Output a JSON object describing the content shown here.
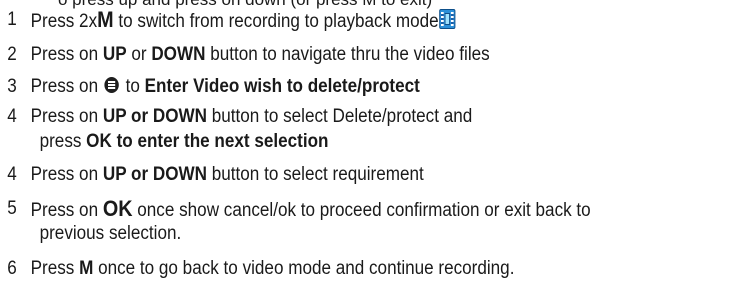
{
  "cutoff_text": "o    press up and press on down (or press M to exit)",
  "steps": [
    {
      "num": "1",
      "pre": "Press 2x",
      "bold": "M",
      "post": " to switch from recording to playback mode",
      "icon": "film-playback-icon"
    },
    {
      "num": "2",
      "pre": "Press on ",
      "b1": "UP",
      "mid": " or ",
      "b2": "DOWN",
      "post": " button to navigate thru the video files"
    },
    {
      "num": "3",
      "pre": "Press on ",
      "mid": " to ",
      "bold": "Enter Video wish to delete/protect",
      "icon": "menu-icon"
    },
    {
      "num": "4",
      "pre": "Press on ",
      "bold": "UP or DOWN",
      "post": " button to select Delete/protect and",
      "line2_pre": "press ",
      "line2_bold": "OK to enter the next selection"
    },
    {
      "num": "4",
      "pre": "Press on ",
      "bold": "UP or DOWN",
      "post": " button to select requirement"
    },
    {
      "num": "5",
      "pre": "Press on ",
      "bold": "OK",
      "post": " once show cancel/ok to proceed confirmation or exit back to",
      "line2": "previous selection."
    },
    {
      "num": "6",
      "pre": "Press ",
      "bold": "M",
      "post": " once to go back to video mode and continue recording."
    }
  ]
}
